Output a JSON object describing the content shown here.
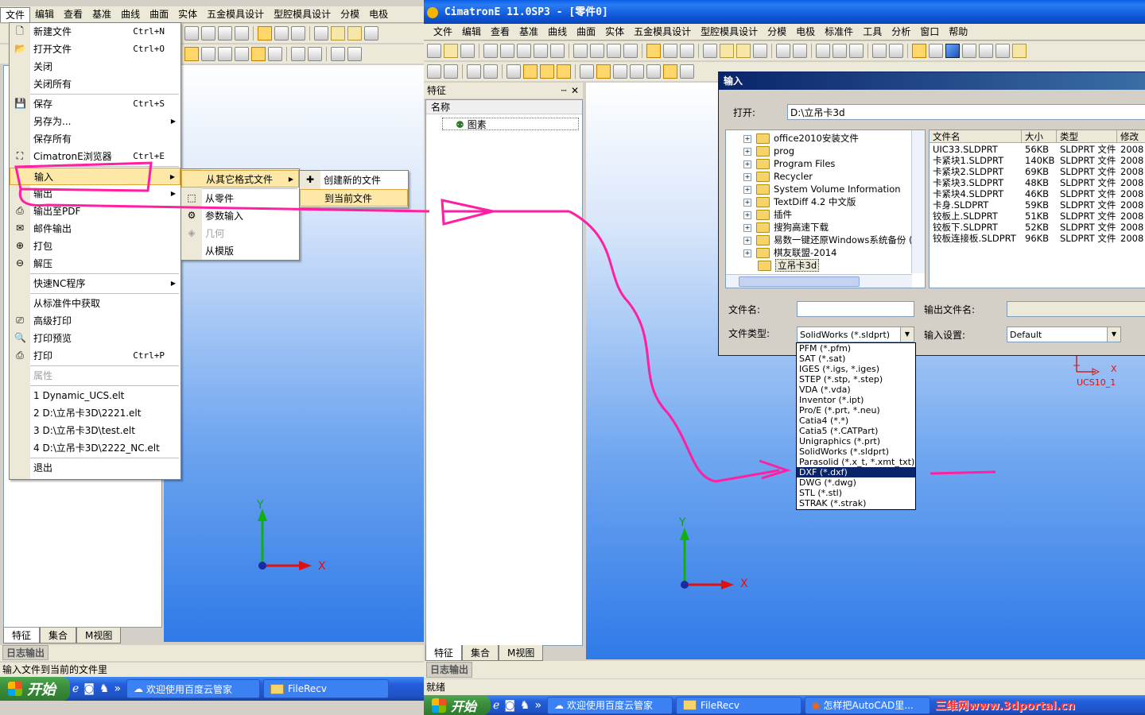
{
  "left_app": {
    "menubar": [
      "文件",
      "编辑",
      "查看",
      "基准",
      "曲线",
      "曲面",
      "实体",
      "五金模具设计",
      "型腔模具设计",
      "分模",
      "电极"
    ],
    "file_menu": [
      {
        "label": "新建文件",
        "shortcut": "Ctrl+N",
        "icon": "new-file-icon"
      },
      {
        "label": "打开文件",
        "shortcut": "Ctrl+O",
        "icon": "open-folder-icon"
      },
      {
        "label": "关闭",
        "shortcut": ""
      },
      {
        "label": "关闭所有",
        "shortcut": ""
      },
      {
        "label": "保存",
        "shortcut": "Ctrl+S",
        "icon": "save-icon"
      },
      {
        "label": "另存为...",
        "shortcut": "",
        "submenu": true
      },
      {
        "label": "保存所有",
        "shortcut": ""
      },
      {
        "label": "CimatronE浏览器",
        "shortcut": "Ctrl+E",
        "icon": "browser-icon"
      },
      {
        "label": "输入",
        "shortcut": "",
        "submenu": true,
        "highlighted": true
      },
      {
        "label": "输出",
        "shortcut": "",
        "submenu": true
      },
      {
        "label": "输出至PDF",
        "shortcut": "",
        "icon": "pdf-icon"
      },
      {
        "label": "邮件输出",
        "shortcut": "",
        "icon": "mail-icon"
      },
      {
        "label": "打包",
        "shortcut": "",
        "icon": "pack-icon"
      },
      {
        "label": "解压",
        "shortcut": "",
        "icon": "unpack-icon"
      },
      {
        "label": "快速NC程序",
        "shortcut": "",
        "submenu": true
      },
      {
        "label": "从标准件中获取",
        "shortcut": ""
      },
      {
        "label": "高级打印",
        "shortcut": "",
        "icon": "advanced-print-icon"
      },
      {
        "label": "打印预览",
        "shortcut": "",
        "icon": "print-preview-icon"
      },
      {
        "label": "打印",
        "shortcut": "Ctrl+P",
        "icon": "printer-icon"
      },
      {
        "label": "属性",
        "shortcut": "",
        "disabled": true
      },
      {
        "label": "1 Dynamic_UCS.elt",
        "shortcut": ""
      },
      {
        "label": "2 D:\\立吊卡3D\\2221.elt",
        "shortcut": ""
      },
      {
        "label": "3 D:\\立吊卡3D\\test.elt",
        "shortcut": ""
      },
      {
        "label": "4 D:\\立吊卡3D\\2222_NC.elt",
        "shortcut": ""
      },
      {
        "label": "退出",
        "shortcut": ""
      }
    ],
    "import_submenu": [
      {
        "label": "从其它格式文件",
        "submenu": true,
        "highlighted": true
      },
      {
        "label": "从零件",
        "icon": "part-icon"
      },
      {
        "label": "参数输入",
        "icon": "param-icon"
      },
      {
        "label": "几何",
        "disabled": true,
        "icon": "geometry-icon"
      },
      {
        "label": "从模版"
      }
    ],
    "other_format_submenu": [
      {
        "label": "创建新的文件",
        "icon": "create-file-icon"
      },
      {
        "label": "到当前文件",
        "highlighted": true
      }
    ],
    "tabs": [
      "特征",
      "集合",
      "M视图"
    ],
    "log_label": "日志输出",
    "status": "输入文件到当前的文件里",
    "taskbar": {
      "start": "开始",
      "items": [
        "欢迎使用百度云管家",
        "FileRecv"
      ]
    },
    "axes": {
      "x": "X",
      "y": "Y"
    }
  },
  "right_app": {
    "title": "CimatronE 11.0SP3 - [零件0]",
    "menubar": [
      "文件",
      "编辑",
      "查看",
      "基准",
      "曲线",
      "曲面",
      "实体",
      "五金模具设计",
      "型腔模具设计",
      "分模",
      "电极",
      "标准件",
      "工具",
      "分析",
      "窗口",
      "帮助"
    ],
    "panel_title": "特征",
    "panel_pin": "ⵈ",
    "panel_close": "✕",
    "tree_header": "名称",
    "tree_item": "图素",
    "tabs": [
      "特征",
      "集合",
      "M视图"
    ],
    "log_label": "日志输出",
    "status": "就绪",
    "taskbar": {
      "start": "开始",
      "items": [
        "欢迎使用百度云管家",
        "FileRecv",
        "怎样把AutoCAD里..."
      ],
      "watermark": "三维网www.3dportal.cn"
    },
    "axes": {
      "x": "X",
      "y": "Y"
    },
    "ucs_label": "UCS10_1",
    "ucs_x": "X"
  },
  "dialog": {
    "title": "输入",
    "open_label": "打开:",
    "open_value": "D:\\立吊卡3d",
    "folders": [
      "office2010安装文件",
      "prog",
      "Program Files",
      "Recycler",
      "System Volume Information",
      "TextDiff 4.2 中文版",
      "插件",
      "搜狗高速下载",
      "易数一键还原Windows系统备份 (",
      "棋友联盟-2014",
      "立吊卡3d"
    ],
    "columns": [
      "文件名",
      "大小",
      "类型",
      "修改"
    ],
    "files": [
      [
        "UIC33.SLDPRT",
        "56KB",
        "SLDPRT 文件",
        "2008"
      ],
      [
        "卡紧块1.SLDPRT",
        "140KB",
        "SLDPRT 文件",
        "2008"
      ],
      [
        "卡紧块2.SLDPRT",
        "69KB",
        "SLDPRT 文件",
        "2008"
      ],
      [
        "卡紧块3.SLDPRT",
        "48KB",
        "SLDPRT 文件",
        "2008"
      ],
      [
        "卡紧块4.SLDPRT",
        "46KB",
        "SLDPRT 文件",
        "2008"
      ],
      [
        "卡身.SLDPRT",
        "59KB",
        "SLDPRT 文件",
        "2008"
      ],
      [
        "铰板上.SLDPRT",
        "51KB",
        "SLDPRT 文件",
        "2008"
      ],
      [
        "铰板下.SLDPRT",
        "52KB",
        "SLDPRT 文件",
        "2008"
      ],
      [
        "铰板连接板.SLDPRT",
        "96KB",
        "SLDPRT 文件",
        "2008"
      ]
    ],
    "filename_label": "文件名:",
    "output_filename_label": "输出文件名:",
    "filetype_label": "文件类型:",
    "filetype_value": "SolidWorks (*.sldprt)",
    "input_settings_label": "输入设置:",
    "input_settings_value": "Default",
    "filetype_options": [
      "PFM (*.pfm)",
      "SAT (*.sat)",
      "IGES (*.igs, *.iges)",
      "STEP (*.stp, *.step)",
      "VDA (*.vda)",
      "Inventor (*.ipt)",
      "Pro/E (*.prt, *.neu)",
      "Catia4 (*.*)",
      "Catia5 (*.CATPart)",
      "Unigraphics (*.prt)",
      "SolidWorks (*.sldprt)",
      "Parasolid (*.x_t, *.xmt_txt)",
      "DXF (*.dxf)",
      "DWG (*.dwg)",
      "STL (*.stl)",
      "STRAK (*.strak)"
    ],
    "selected_option": "DXF (*.dxf)"
  }
}
